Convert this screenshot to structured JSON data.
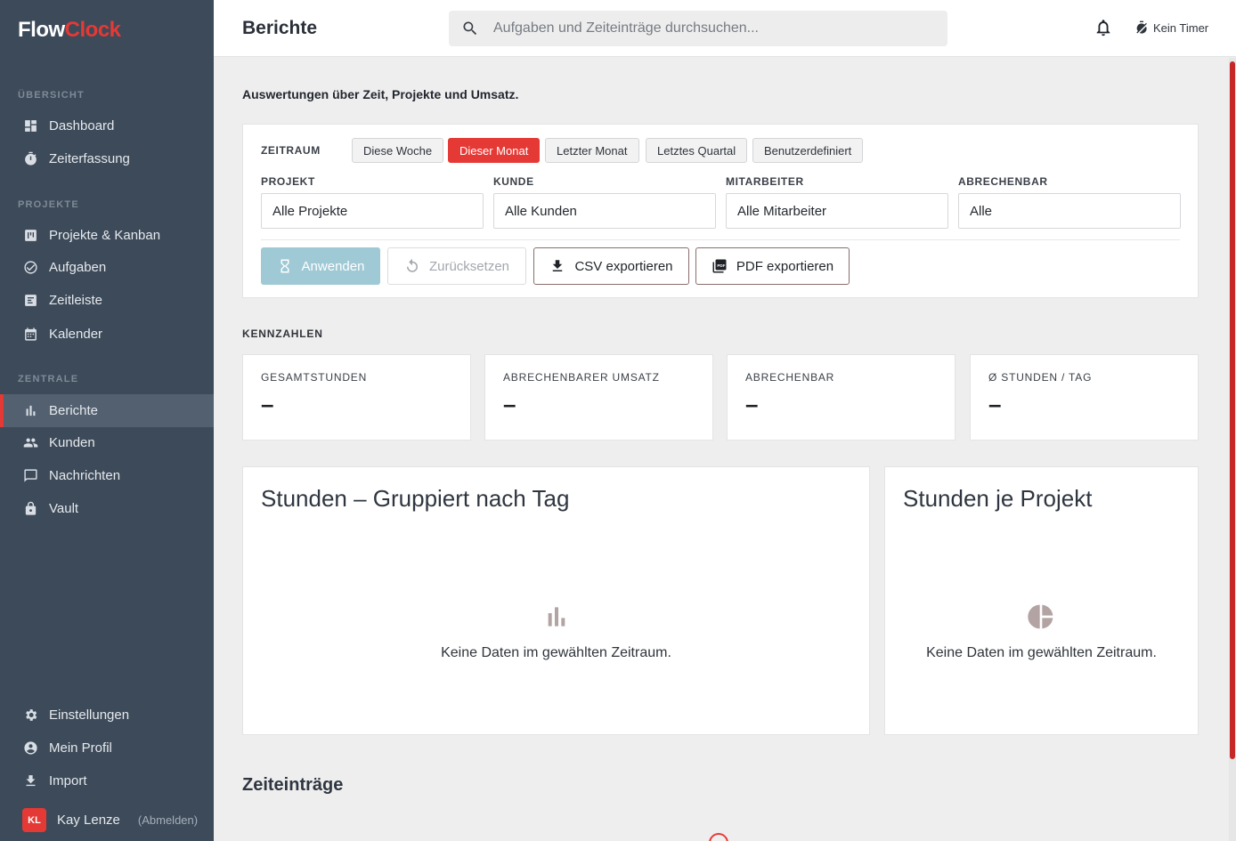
{
  "brand": {
    "part1": "Flow",
    "part2": "Clock"
  },
  "sidebar": {
    "sections": [
      {
        "title": "ÜBERSICHT"
      },
      {
        "title": "PROJEKTE"
      },
      {
        "title": "ZENTRALE"
      }
    ],
    "items": [
      {
        "label": "Dashboard",
        "icon": "dashboard-icon"
      },
      {
        "label": "Zeiterfassung",
        "icon": "stopwatch-icon"
      },
      {
        "label": "Projekte & Kanban",
        "icon": "kanban-icon"
      },
      {
        "label": "Aufgaben",
        "icon": "check-circle-icon"
      },
      {
        "label": "Zeitleiste",
        "icon": "timeline-icon"
      },
      {
        "label": "Kalender",
        "icon": "calendar-icon"
      },
      {
        "label": "Berichte",
        "icon": "bar-chart-icon",
        "active": true
      },
      {
        "label": "Kunden",
        "icon": "people-icon"
      },
      {
        "label": "Nachrichten",
        "icon": "message-icon"
      },
      {
        "label": "Vault",
        "icon": "lock-icon"
      },
      {
        "label": "Einstellungen",
        "icon": "gear-icon"
      },
      {
        "label": "Mein Profil",
        "icon": "account-icon"
      },
      {
        "label": "Import",
        "icon": "download-icon"
      }
    ],
    "user": {
      "initials": "KL",
      "name": "Kay Lenze",
      "logout": "(Abmelden)"
    }
  },
  "header": {
    "title": "Berichte",
    "search_placeholder": "Aufgaben und Zeiteinträge durchsuchen...",
    "timer": "Kein Timer"
  },
  "main": {
    "subtitle": "Auswertungen über Zeit, Projekte und Umsatz.",
    "filters": {
      "period_label": "ZEITRAUM",
      "periods": [
        "Diese Woche",
        "Dieser Monat",
        "Letzter Monat",
        "Letztes Quartal",
        "Benutzerdefiniert"
      ],
      "active_period": "Dieser Monat",
      "fields": [
        {
          "label": "PROJEKT",
          "value": "Alle Projekte"
        },
        {
          "label": "KUNDE",
          "value": "Alle Kunden"
        },
        {
          "label": "MITARBEITER",
          "value": "Alle Mitarbeiter"
        },
        {
          "label": "ABRECHENBAR",
          "value": "Alle"
        }
      ],
      "buttons": {
        "apply": "Anwenden",
        "reset": "Zurücksetzen",
        "csv": "CSV exportieren",
        "pdf": "PDF exportieren"
      }
    },
    "kpi_title": "KENNZAHLEN",
    "kpis": [
      {
        "label": "GESAMTSTUNDEN",
        "value": "–"
      },
      {
        "label": "ABRECHENBARER UMSATZ",
        "value": "–"
      },
      {
        "label": "ABRECHENBAR",
        "value": "–"
      },
      {
        "label": "Ø STUNDEN / TAG",
        "value": "–"
      }
    ],
    "charts": [
      {
        "title": "Stunden – Gruppiert nach Tag",
        "empty": "Keine Daten im gewählten Zeitraum.",
        "icon": "bar-chart-icon"
      },
      {
        "title": "Stunden je Projekt",
        "empty": "Keine Daten im gewählten Zeitraum.",
        "icon": "pie-chart-icon"
      }
    ],
    "entries_title": "Zeiteinträge"
  },
  "colors": {
    "accent": "#e53935",
    "sidebar": "#3d4a59",
    "apply": "#9fc9d5"
  }
}
